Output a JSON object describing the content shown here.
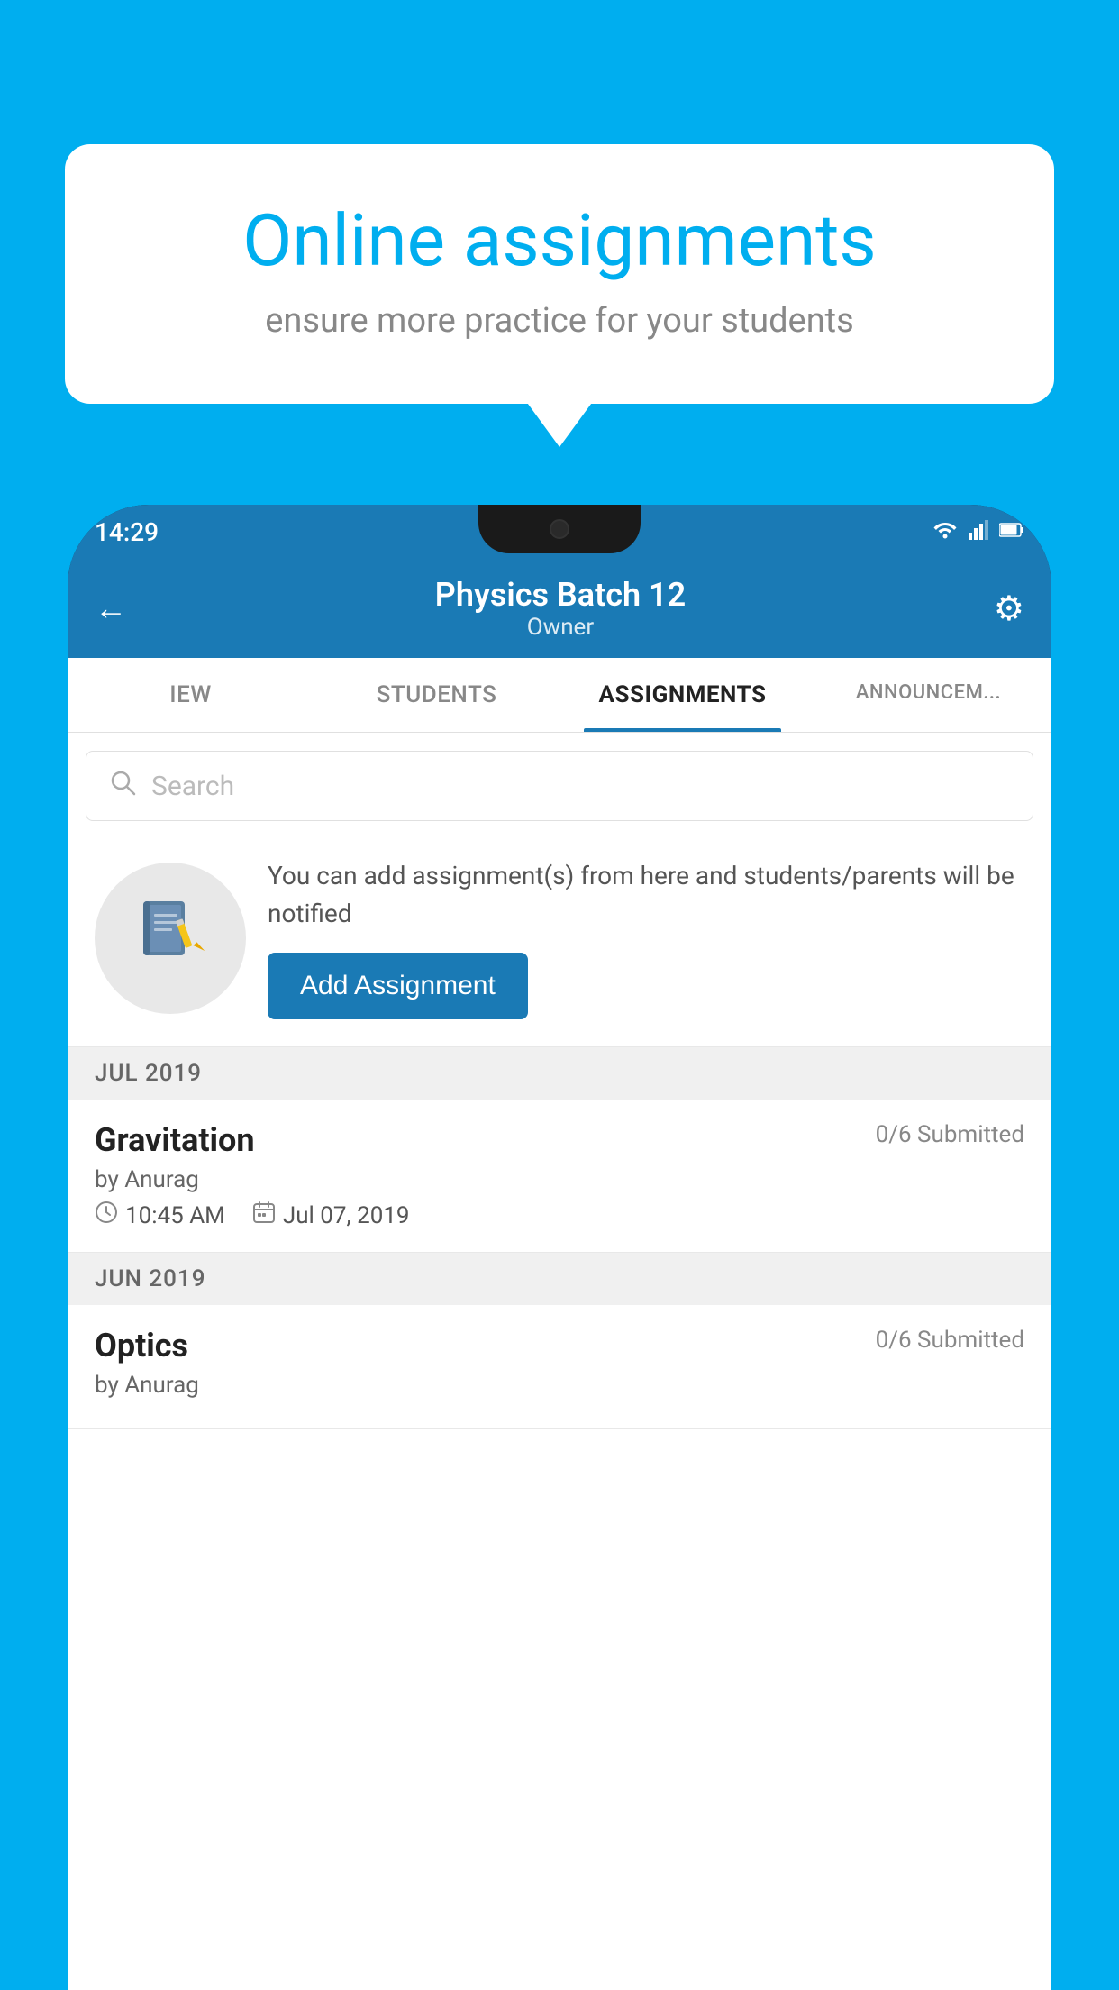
{
  "background_color": "#00AEEF",
  "speech_bubble": {
    "title": "Online assignments",
    "subtitle": "ensure more practice for your students"
  },
  "status_bar": {
    "time": "14:29",
    "wifi": "▲",
    "signal": "▲",
    "battery": "▮"
  },
  "header": {
    "title": "Physics Batch 12",
    "subtitle": "Owner",
    "back_label": "←",
    "settings_label": "⚙"
  },
  "tabs": [
    {
      "id": "iew",
      "label": "IEW",
      "active": false
    },
    {
      "id": "students",
      "label": "STUDENTS",
      "active": false
    },
    {
      "id": "assignments",
      "label": "ASSIGNMENTS",
      "active": true
    },
    {
      "id": "announcements",
      "label": "ANNOUNCEM...",
      "active": false
    }
  ],
  "search": {
    "placeholder": "Search"
  },
  "promo": {
    "text": "You can add assignment(s) from here and students/parents will be notified",
    "button_label": "Add Assignment"
  },
  "sections": [
    {
      "month_label": "JUL 2019",
      "assignments": [
        {
          "title": "Gravitation",
          "submitted": "0/6 Submitted",
          "author": "by Anurag",
          "time": "10:45 AM",
          "date": "Jul 07, 2019"
        }
      ]
    },
    {
      "month_label": "JUN 2019",
      "assignments": [
        {
          "title": "Optics",
          "submitted": "0/6 Submitted",
          "author": "by Anurag",
          "time": "",
          "date": ""
        }
      ]
    }
  ]
}
